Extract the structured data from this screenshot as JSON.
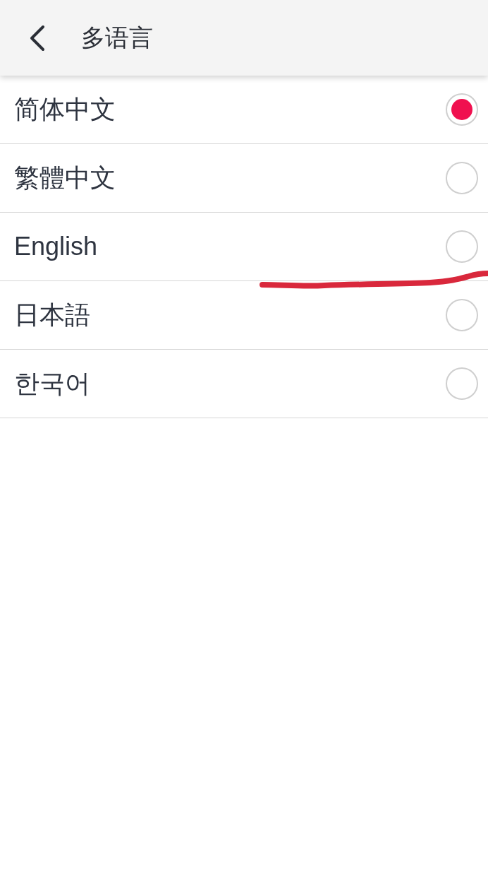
{
  "header": {
    "title": "多语言"
  },
  "languages": [
    {
      "label": "简体中文",
      "selected": true
    },
    {
      "label": "繁體中文",
      "selected": false
    },
    {
      "label": "English",
      "selected": false
    },
    {
      "label": "日本語",
      "selected": false
    },
    {
      "label": "한국어",
      "selected": false
    }
  ]
}
